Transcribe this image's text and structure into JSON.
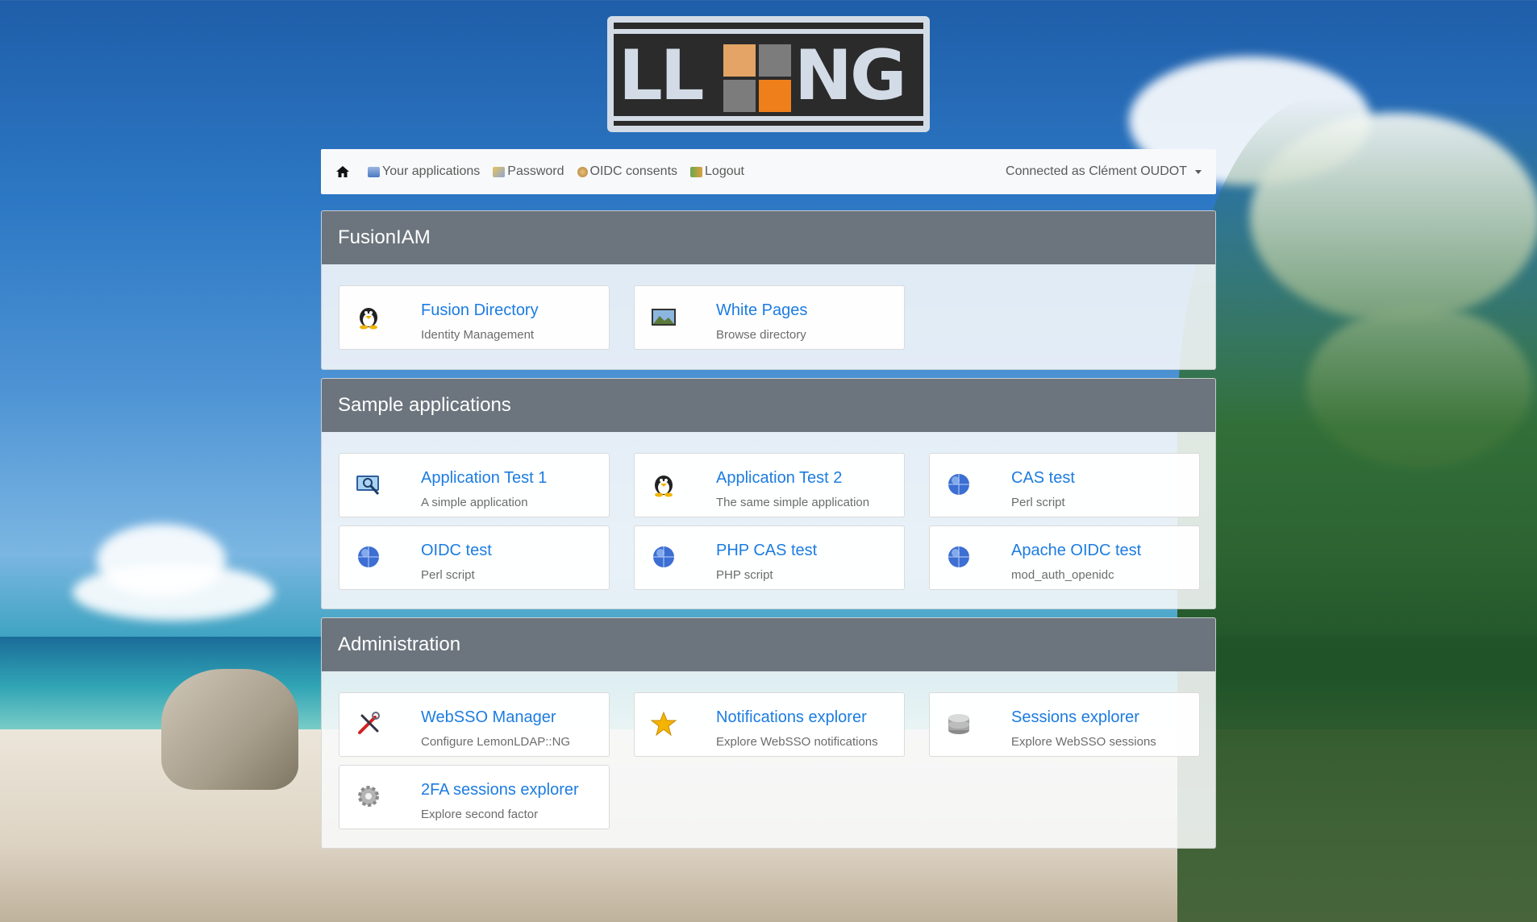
{
  "logo": {
    "text_left": "LL",
    "text_right": "NG"
  },
  "navbar": {
    "items": [
      {
        "label": "Your applications",
        "icon": "applications-icon"
      },
      {
        "label": "Password",
        "icon": "password-icon"
      },
      {
        "label": "OIDC consents",
        "icon": "oidc-consents-icon"
      },
      {
        "label": "Logout",
        "icon": "logout-icon"
      }
    ],
    "user_menu": "Connected as Clément OUDOT"
  },
  "categories": [
    {
      "title": "FusionIAM",
      "apps": [
        {
          "name": "Fusion Directory",
          "description": "Identity Management",
          "icon": "penguin-icon"
        },
        {
          "name": "White Pages",
          "description": "Browse directory",
          "icon": "picture-icon"
        }
      ]
    },
    {
      "title": "Sample applications",
      "apps": [
        {
          "name": "Application Test 1",
          "description": "A simple application",
          "icon": "monitor-search-icon"
        },
        {
          "name": "Application Test 2",
          "description": "The same simple application",
          "icon": "penguin-icon"
        },
        {
          "name": "CAS test",
          "description": "Perl script",
          "icon": "globe-icon"
        },
        {
          "name": "OIDC test",
          "description": "Perl script",
          "icon": "globe-icon"
        },
        {
          "name": "PHP CAS test",
          "description": "PHP script",
          "icon": "globe-icon"
        },
        {
          "name": "Apache OIDC test",
          "description": "mod_auth_openidc",
          "icon": "globe-icon"
        }
      ]
    },
    {
      "title": "Administration",
      "apps": [
        {
          "name": "WebSSO Manager",
          "description": "Configure LemonLDAP::NG",
          "icon": "tools-icon"
        },
        {
          "name": "Notifications explorer",
          "description": "Explore WebSSO notifications",
          "icon": "star-icon"
        },
        {
          "name": "Sessions explorer",
          "description": "Explore WebSSO sessions",
          "icon": "database-icon"
        },
        {
          "name": "2FA sessions explorer",
          "description": "Explore second factor",
          "icon": "gear-icon"
        }
      ]
    }
  ]
}
